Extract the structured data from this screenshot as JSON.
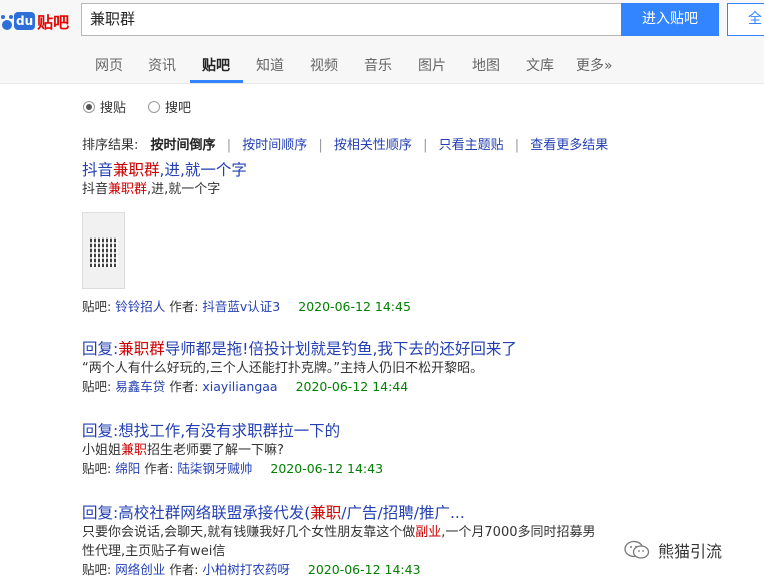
{
  "header": {
    "logo_du": "du",
    "logo_tieba": "贴吧",
    "search_value": "兼职群",
    "enter_button": "进入贴吧",
    "all_button": "全"
  },
  "tabs": [
    {
      "label": "网页"
    },
    {
      "label": "资讯"
    },
    {
      "label": "贴吧"
    },
    {
      "label": "知道"
    },
    {
      "label": "视频"
    },
    {
      "label": "音乐"
    },
    {
      "label": "图片"
    },
    {
      "label": "地图"
    },
    {
      "label": "文库"
    },
    {
      "label": "更多»"
    }
  ],
  "radios": {
    "search_posts": "搜贴",
    "search_bars": "搜吧"
  },
  "sort": {
    "prefix": "排序结果:",
    "current": "按时间倒序",
    "options": [
      "按时间顺序",
      "按相关性顺序",
      "只看主题贴",
      "查看更多结果"
    ]
  },
  "results": [
    {
      "title_parts": [
        "抖音",
        "兼职群",
        ",进,就一个字"
      ],
      "desc_parts": [
        "抖音",
        "兼职群",
        ",进,就一个字"
      ],
      "bar_label": "贴吧:",
      "bar": "铃铃招人",
      "author_label": "作者:",
      "author": "抖音蓝v认证3",
      "date": "2020-06-12 14:45"
    },
    {
      "title_parts": [
        "回复:",
        "兼职群",
        "导师都是拖!倍投计划就是钓鱼,我下去的还好回来了"
      ],
      "desc": "“两个人有什么好玩的,三个人还能打扑克牌。”主持人仍旧不松开黎昭。",
      "bar_label": "贴吧:",
      "bar": "易鑫车贷",
      "author_label": "作者:",
      "author": "xiayiliangaa",
      "date": "2020-06-12 14:44"
    },
    {
      "title": "回复:想找工作,有没有求职群拉一下的",
      "desc_parts": [
        "小姐姐",
        "兼职",
        "招生老师要了解一下嘛?"
      ],
      "bar_label": "贴吧:",
      "bar": "绵阳",
      "author_label": "作者:",
      "author": "陆柒钢牙贼帅",
      "date": "2020-06-12 14:43"
    },
    {
      "title_parts": [
        "回复:高校社群网络联盟承接代发(",
        "兼职",
        "/广告/招聘/推广..."
      ],
      "desc_line1_parts": [
        "只要你会说话,会聊天,就有钱赚我好几个女性朋友靠这个做",
        "副业",
        ",一个月7000多同时招募男"
      ],
      "desc_line2": "性代理,主页贴子有wei信",
      "bar_label": "贴吧:",
      "bar": "网络创业",
      "author_label": "作者:",
      "author": "小柏树打农药呀",
      "date": "2020-06-12 14:43"
    }
  ],
  "watermark": "熊猫引流",
  "colors": {
    "link": "#2440b3",
    "highlight": "#cc0000",
    "date": "#008000",
    "accent": "#3385ff"
  }
}
